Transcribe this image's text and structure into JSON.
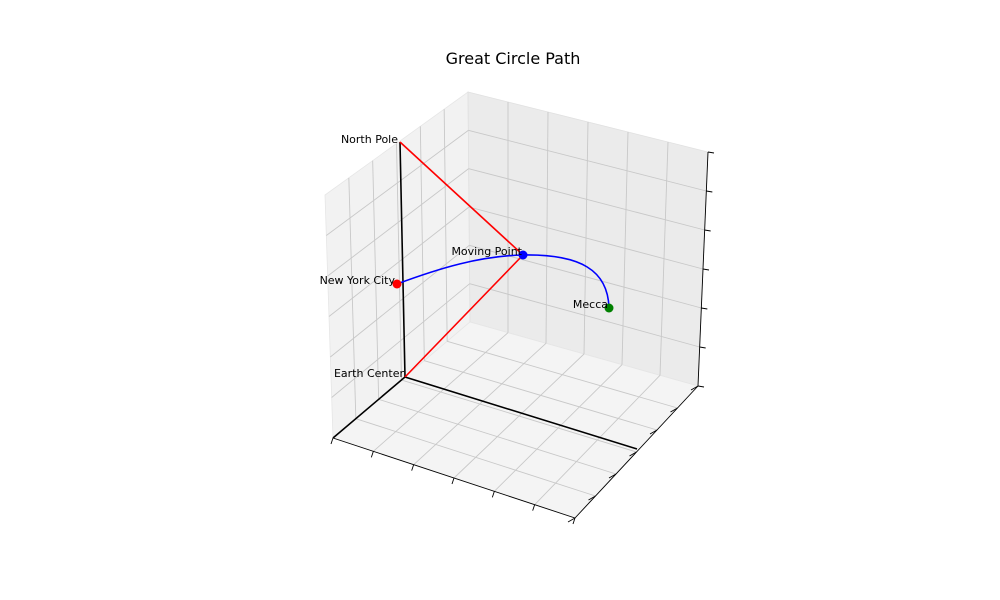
{
  "chart_data": {
    "type": "line",
    "projection": "3d",
    "title": "Great Circle Path",
    "xlabel": "",
    "ylabel": "",
    "zlabel": "",
    "tick_labels_shown": false,
    "grid": true,
    "points": [
      {
        "label": "North Pole",
        "color": "#000000",
        "marker": false
      },
      {
        "label": "New York City",
        "color": "#ff0000",
        "marker": true
      },
      {
        "label": "Moving Point",
        "color": "#0000ff",
        "marker": true
      },
      {
        "label": "Mecca",
        "color": "#008000",
        "marker": true
      },
      {
        "label": "Earth Center",
        "color": "#000000",
        "marker": false
      }
    ],
    "segments": [
      {
        "from": "Earth Center",
        "to": "North Pole",
        "color": "#000000"
      },
      {
        "from": "Earth Center",
        "to": "New York City",
        "color": "#000000"
      },
      {
        "from": "Earth Center",
        "to": "Moving Point",
        "color": "#ff0000"
      },
      {
        "from": "North Pole",
        "to": "Moving Point",
        "color": "#ff0000"
      },
      {
        "from": "Earth Center",
        "to": "x-axis end",
        "color": "#000000"
      },
      {
        "from": "Earth Center",
        "to": "y-axis end",
        "color": "#000000"
      }
    ],
    "path": {
      "from": "New York City",
      "through": "Moving Point",
      "to": "Mecca",
      "color": "#0000ff",
      "type": "great-circle arc"
    }
  },
  "colors": {
    "pane_left": "#f2f2f2",
    "pane_back": "#ebebeb",
    "pane_floor": "#f4f4f4",
    "grid": "#c8c8c8",
    "path": "#0000ff",
    "triangle": "#ff0000",
    "axes": "#000000"
  }
}
